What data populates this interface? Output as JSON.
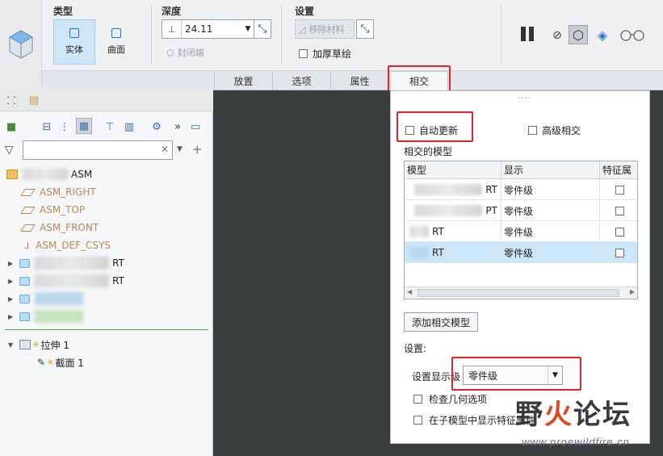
{
  "ribbon": {
    "groups": {
      "type": "类型",
      "depth": "深度",
      "settings": "设置"
    },
    "type_buttons": {
      "solid": "实体",
      "surface": "曲面"
    },
    "depth_value": "24.11",
    "remove_material": "移除材料",
    "close_end": "封闭端",
    "thicken_sketch": "加厚草绘"
  },
  "tabs": [
    "放置",
    "选项",
    "属性",
    "相交"
  ],
  "model_tree": {
    "items": [
      {
        "label": "ASM",
        "kind": "assembly"
      },
      {
        "label": "ASM_RIGHT",
        "kind": "datum-plane"
      },
      {
        "label": "ASM_TOP",
        "kind": "datum-plane"
      },
      {
        "label": "ASM_FRONT",
        "kind": "datum-plane"
      },
      {
        "label": "ASM_DEF_CSYS",
        "kind": "csys"
      },
      {
        "label": "RT",
        "kind": "part"
      },
      {
        "label": "RT",
        "kind": "part"
      }
    ],
    "extrude": "拉伸 1",
    "section": "截面 1"
  },
  "intersect_panel": {
    "auto_update": "自动更新",
    "advanced": "高级相交",
    "models_label": "相交的模型",
    "columns": [
      "模型",
      "显示",
      "特征属"
    ],
    "rows": [
      {
        "model": "RT",
        "display": "零件级",
        "selected": false
      },
      {
        "model": "PT",
        "display": "零件级",
        "selected": false
      },
      {
        "model": "RT",
        "display": "零件级",
        "selected": false
      },
      {
        "model": "RT",
        "display": "零件级",
        "selected": true
      }
    ],
    "add_button": "添加相交模型",
    "settings_label": "设置:",
    "display_level_label": "设置显示级",
    "display_level_value": "零件级",
    "check_geometry": "检查几何选项",
    "show_in_child": "在子模型中显示特征属性"
  },
  "watermark": {
    "title_part1": "野",
    "title_accent": "火",
    "title_part2": "论坛",
    "url": "www.proewildfire.cn"
  },
  "colors": {
    "highlight": "#e0252a",
    "selected_row": "#cce5f9",
    "ribbon_bg": "#eef0f2",
    "graphics_bg": "#383c3c"
  }
}
